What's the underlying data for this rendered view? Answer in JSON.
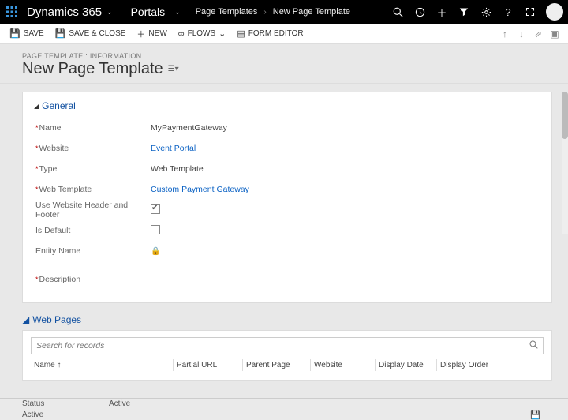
{
  "nav": {
    "brand": "Dynamics 365",
    "section": "Portals",
    "crumb1": "Page Templates",
    "crumb2": "New Page Template"
  },
  "toolbar": {
    "save": "SAVE",
    "saveclose": "SAVE & CLOSE",
    "new": "NEW",
    "flows": "FLOWS",
    "formeditor": "FORM EDITOR"
  },
  "header": {
    "pretitle": "PAGE TEMPLATE : INFORMATION",
    "title": "New Page Template"
  },
  "general": {
    "heading": "General",
    "labels": {
      "name": "Name",
      "website": "Website",
      "type": "Type",
      "webtemplate": "Web Template",
      "usehf": "Use Website Header and Footer",
      "isdefault": "Is Default",
      "entity": "Entity Name",
      "description": "Description"
    },
    "values": {
      "name": "MyPaymentGateway",
      "website": "Event Portal",
      "type": "Web Template",
      "webtemplate": "Custom Payment Gateway",
      "usehf": true,
      "isdefault": false,
      "entity": "",
      "description": ""
    }
  },
  "webpages": {
    "heading": "Web Pages",
    "search_placeholder": "Search for records",
    "cols": {
      "name": "Name ↑",
      "partialurl": "Partial URL",
      "parentpage": "Parent Page",
      "website": "Website",
      "displaydate": "Display Date",
      "displayorder": "Display Order"
    }
  },
  "status": {
    "row1_label": "Status",
    "row1_value": "Active",
    "row2_label": "Active"
  }
}
